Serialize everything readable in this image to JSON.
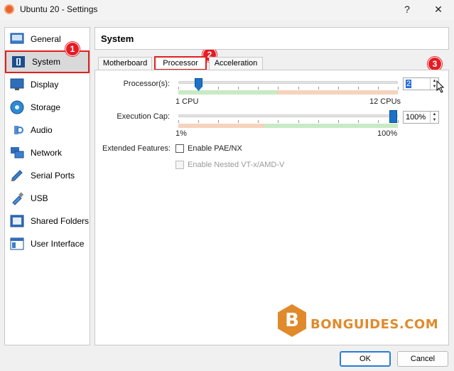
{
  "window": {
    "title": "Ubuntu 20 - Settings",
    "help_label": "?",
    "close_label": "✕"
  },
  "sidebar": {
    "items": [
      {
        "label": "General",
        "icon": "general-icon"
      },
      {
        "label": "System",
        "icon": "system-icon",
        "selected": true
      },
      {
        "label": "Display",
        "icon": "display-icon"
      },
      {
        "label": "Storage",
        "icon": "storage-icon"
      },
      {
        "label": "Audio",
        "icon": "audio-icon"
      },
      {
        "label": "Network",
        "icon": "network-icon"
      },
      {
        "label": "Serial Ports",
        "icon": "serial-ports-icon"
      },
      {
        "label": "USB",
        "icon": "usb-icon"
      },
      {
        "label": "Shared Folders",
        "icon": "shared-folders-icon"
      },
      {
        "label": "User Interface",
        "icon": "user-interface-icon"
      }
    ]
  },
  "markers": {
    "m1": "1",
    "m2": "2",
    "m3": "3"
  },
  "header": {
    "title": "System"
  },
  "tabs": [
    {
      "label": "Motherboard"
    },
    {
      "label": "Processor",
      "active": true
    },
    {
      "label": "Acceleration"
    }
  ],
  "processor": {
    "label": "Processor(s):",
    "min_label": "1 CPU",
    "max_label": "12 CPUs",
    "value": "2",
    "min": 1,
    "max": 12
  },
  "execution_cap": {
    "label": "Execution Cap:",
    "min_label": "1%",
    "max_label": "100%",
    "value": "100%",
    "level": 100
  },
  "extended_features": {
    "label": "Extended Features:",
    "pae_label": "Enable PAE/NX",
    "nested_label": "Enable Nested VT-x/AMD-V"
  },
  "watermark": {
    "text": "BONGUIDES.COM",
    "logo_letter": "B"
  },
  "buttons": {
    "ok": "OK",
    "cancel": "Cancel"
  },
  "colors": {
    "accent": "#1a73c8",
    "marker_red": "#e51c23",
    "zone_green": "#c8eac4",
    "zone_orange": "#f6d3bd",
    "logo_orange": "#e08a2c"
  }
}
